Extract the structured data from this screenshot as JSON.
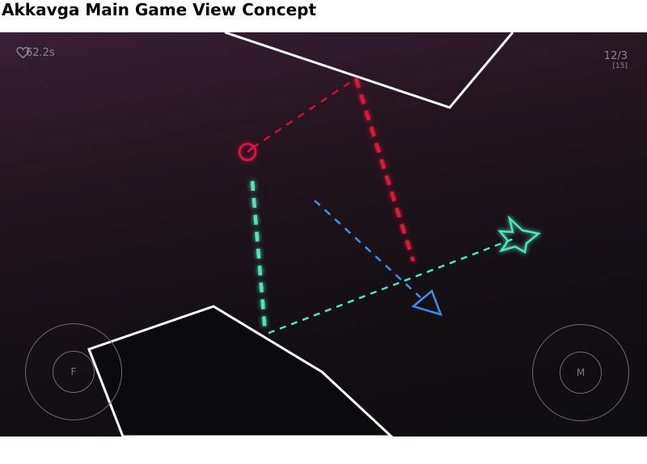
{
  "page": {
    "title": "Akkavga Main Game View Concept"
  },
  "hud": {
    "lives": [
      "heart-icon",
      "heart-icon",
      "heart-icon"
    ],
    "timer": "62.2s",
    "score": "12/3",
    "score_sub": "[15]"
  },
  "controls": {
    "left_stick_label": "F",
    "right_stick_label": "M"
  },
  "colors": {
    "bg_top": "#3a1f36",
    "bg_bottom": "#0e0d0f",
    "wall": "#ffffff",
    "red": "#e0143c",
    "cyan": "#4fe3c0",
    "blue": "#3f8fe8",
    "hud_text": "#8c8590"
  },
  "entities": {
    "player_target": "circle-target-icon",
    "star": "star-icon",
    "arrow": "triangle-arrow-icon"
  }
}
